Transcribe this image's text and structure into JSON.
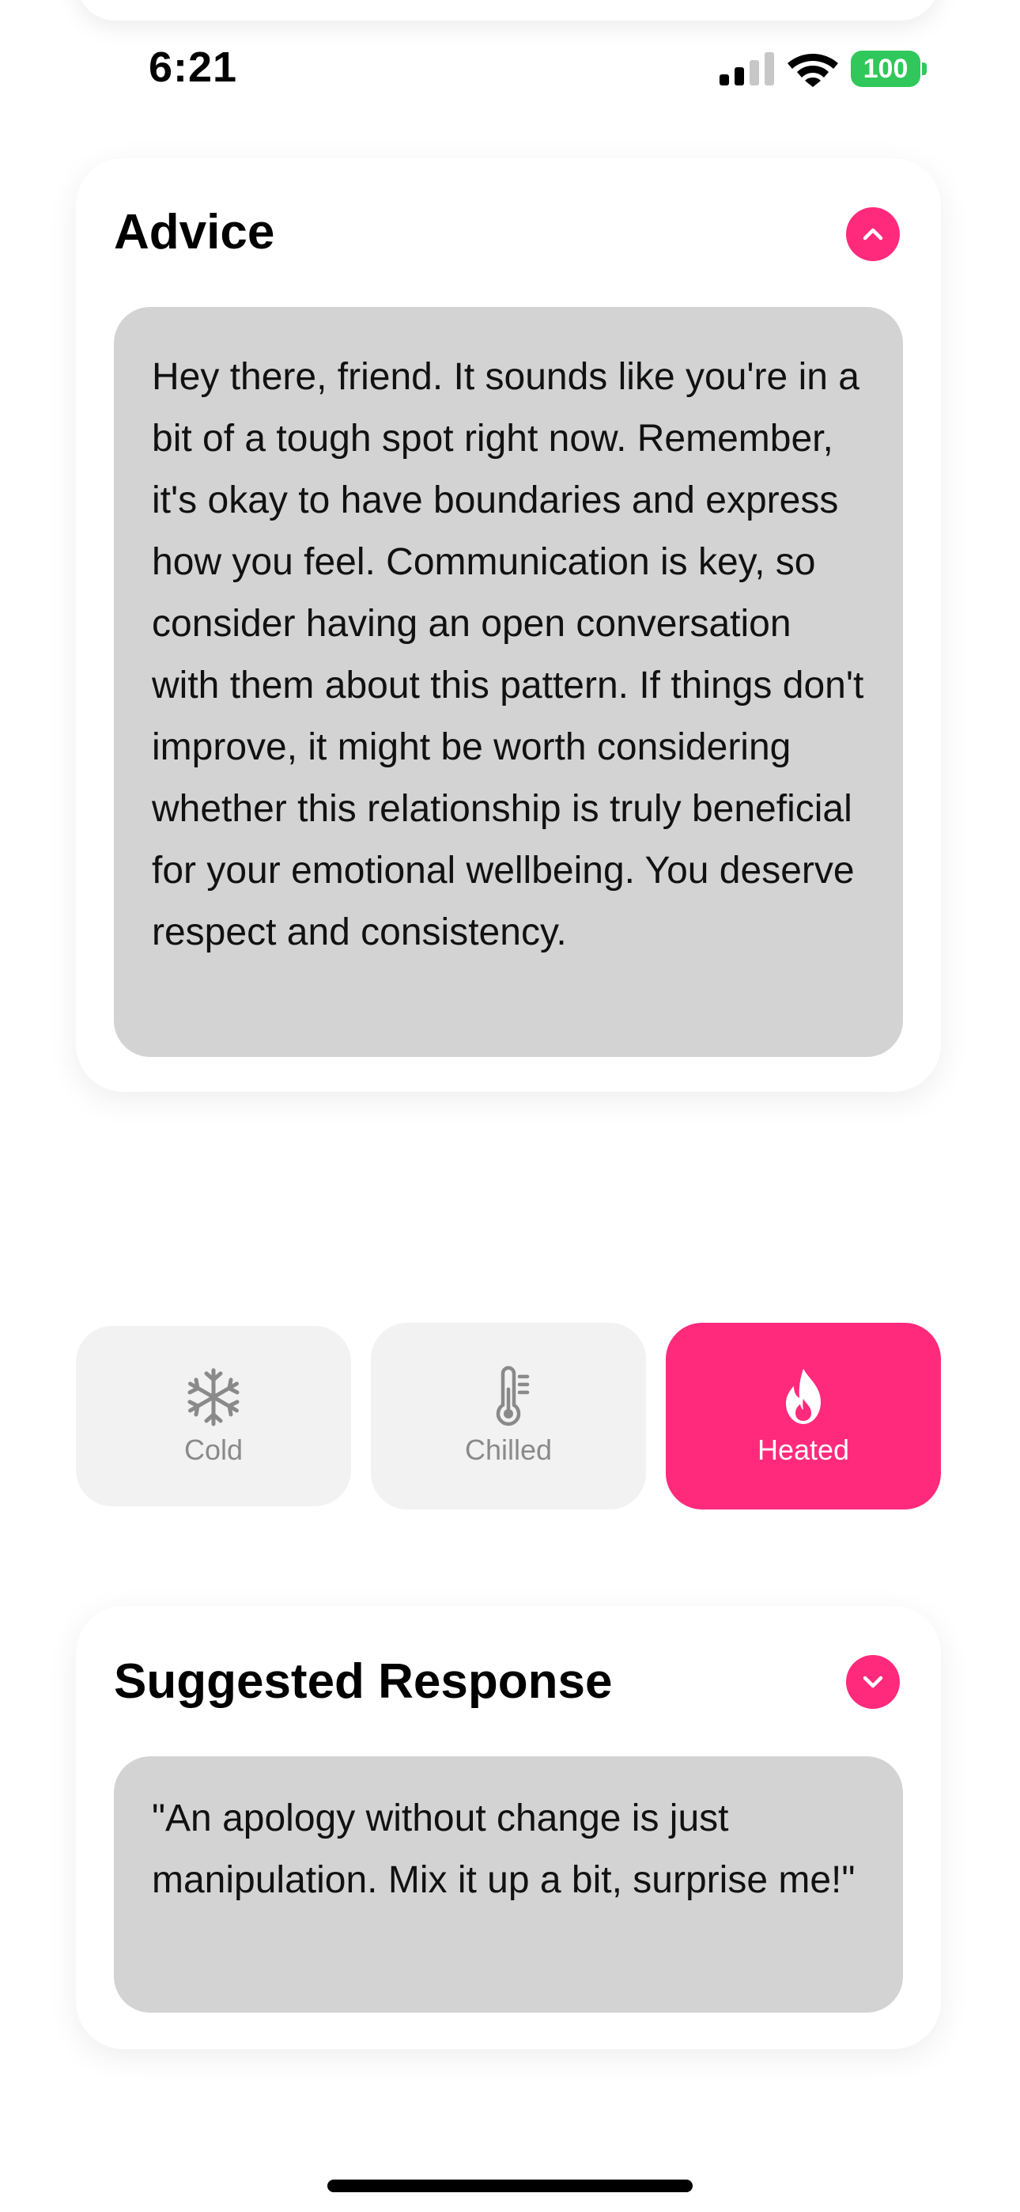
{
  "status_bar": {
    "time": "6:21",
    "battery": "100"
  },
  "advice": {
    "title": "Advice",
    "body": "Hey there, friend. It sounds like you're in a bit of a tough spot right now. Remember, it's okay to have boundaries and express how you feel. Communication is key, so consider having an open conversation with them about this pattern. If things don't improve, it might be worth considering whether this relationship is truly beneficial for your emotional wellbeing. You deserve respect and consistency.",
    "toggle_icon": "chevron-up-icon"
  },
  "tone_selector": {
    "options": [
      {
        "label": "Cold",
        "icon": "snowflake-icon",
        "selected": false
      },
      {
        "label": "Chilled",
        "icon": "thermometer-icon",
        "selected": false
      },
      {
        "label": "Heated",
        "icon": "flame-icon",
        "selected": true
      }
    ]
  },
  "suggested_response": {
    "title": "Suggested Response",
    "body": "\"An apology without change is just manipulation. Mix it up a bit, surprise me!\"",
    "toggle_icon": "chevron-down-icon"
  },
  "colors": {
    "accent": "#ff2a7c",
    "bubble": "#d3d3d3",
    "button_inactive": "#f2f2f2",
    "battery": "#30c85a"
  }
}
